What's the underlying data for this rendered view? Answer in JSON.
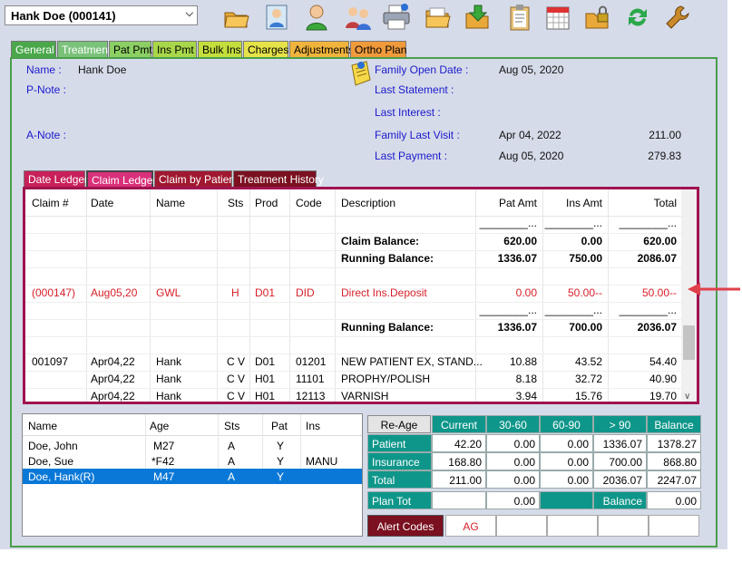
{
  "header": {
    "patient_selector": "Hank Doe (000141)"
  },
  "toolbar": {
    "icons": [
      "folder-icon",
      "patient-photo-icon",
      "person-icon",
      "family-icon",
      "printer-icon",
      "folder-open-icon",
      "download-folder-icon",
      "clipboard-icon",
      "calendar-icon",
      "lock-folder-icon",
      "refresh-icon",
      "wrench-icon"
    ]
  },
  "main_tabs": [
    {
      "label": "General",
      "color": "#4aa84a"
    },
    {
      "label": "Treatment",
      "color": "#7ac27a"
    },
    {
      "label": "Pat Pmt",
      "color": "#8ccf64"
    },
    {
      "label": "Ins Pmt",
      "color": "#a8d84a"
    },
    {
      "label": "Bulk Ins",
      "color": "#c4de3e"
    },
    {
      "label": "Charges",
      "color": "#e5e24a"
    },
    {
      "label": "Adjustments",
      "color": "#f0b43c"
    },
    {
      "label": "Ortho Plan",
      "color": "#f09a3c"
    }
  ],
  "info": {
    "name_label": "Name :",
    "name_value": "Hank Doe",
    "pnote_label": "P-Note :",
    "anote_label": "A-Note :",
    "family_open_date_label": "Family Open Date :",
    "family_open_date_value": "Aug 05, 2020",
    "last_statement_label": "Last Statement :",
    "last_interest_label": "Last Interest :",
    "family_last_visit_label": "Family Last Visit :",
    "family_last_visit_date": "Apr 04, 2022",
    "family_last_visit_amount": "211.00",
    "last_payment_label": "Last Payment :",
    "last_payment_date": "Aug 05, 2020",
    "last_payment_amount": "279.83"
  },
  "ledger_tabs": [
    {
      "label": "Date Ledger",
      "color": "#c8205a"
    },
    {
      "label": "Claim Ledger",
      "color": "#d8307a"
    },
    {
      "label": "Claim by Patient",
      "color": "#a01830"
    },
    {
      "label": "Treatment History",
      "color": "#7a1020"
    }
  ],
  "ledger": {
    "columns": [
      "Claim #",
      "Date",
      "Name",
      "Sts",
      "Prod",
      "Code",
      "Description",
      "Pat Amt",
      "Ins Amt",
      "Total"
    ],
    "dashes": "________...",
    "claim_balance": {
      "label": "Claim Balance:",
      "pat": "620.00",
      "ins": "0.00",
      "total": "620.00"
    },
    "running_balance_1": {
      "label": "Running Balance:",
      "pat": "1336.07",
      "ins": "750.00",
      "total": "2086.07"
    },
    "red_row": {
      "claim": "(000147)",
      "date": "Aug05,20",
      "name": "GWL",
      "sts": "H",
      "prod": "D01",
      "code": "DID",
      "desc": "Direct Ins.Deposit",
      "pat": "0.00",
      "ins": "50.00--",
      "total": "50.00--"
    },
    "running_balance_2": {
      "label": "Running Balance:",
      "pat": "1336.07",
      "ins": "700.00",
      "total": "2036.07"
    },
    "rows": [
      {
        "claim": "001097",
        "date": "Apr04,22",
        "name": "Hank",
        "sts": "C V",
        "prod": "D01",
        "code": "01201",
        "desc": "NEW PATIENT EX, STAND...",
        "pat": "10.88",
        "ins": "43.52",
        "total": "54.40"
      },
      {
        "claim": "",
        "date": "Apr04,22",
        "name": "Hank",
        "sts": "C V",
        "prod": "H01",
        "code": "11101",
        "desc": "PROPHY/POLISH",
        "pat": "8.18",
        "ins": "32.72",
        "total": "40.90"
      },
      {
        "claim": "",
        "date": "Apr04,22",
        "name": "Hank",
        "sts": "C V",
        "prod": "H01",
        "code": "12113",
        "desc": "VARNISH",
        "pat": "3.94",
        "ins": "15.76",
        "total": "19.70"
      }
    ]
  },
  "family": {
    "columns": [
      "Name",
      "Age",
      "Sts",
      "Pat",
      "Ins"
    ],
    "members": [
      {
        "name": "Doe, John",
        "age": "M27",
        "sts": "A",
        "pat": "Y",
        "ins": ""
      },
      {
        "name": "Doe, Sue",
        "age": "*F42",
        "sts": "A",
        "pat": "Y",
        "ins": "MANU"
      },
      {
        "name": "Doe, Hank(R)",
        "age": "M47",
        "sts": "A",
        "pat": "Y",
        "ins": ""
      }
    ]
  },
  "aging": {
    "reage_label": "Re-Age",
    "columns": [
      "Current",
      "30-60",
      "60-90",
      "> 90",
      "Balance"
    ],
    "rows": [
      {
        "label": "Patient",
        "values": [
          "42.20",
          "0.00",
          "0.00",
          "1336.07",
          "1378.27"
        ]
      },
      {
        "label": "Insurance",
        "values": [
          "168.80",
          "0.00",
          "0.00",
          "700.00",
          "868.80"
        ]
      },
      {
        "label": "Total",
        "values": [
          "211.00",
          "0.00",
          "0.00",
          "2036.07",
          "2247.07"
        ]
      }
    ],
    "plan_tot_label": "Plan Tot",
    "plan_tot_value": "0.00",
    "balance_label": "Balance",
    "balance_value": "0.00"
  },
  "alerts": {
    "button_label": "Alert Codes",
    "codes": [
      "AG",
      "",
      "",
      "",
      ""
    ]
  }
}
